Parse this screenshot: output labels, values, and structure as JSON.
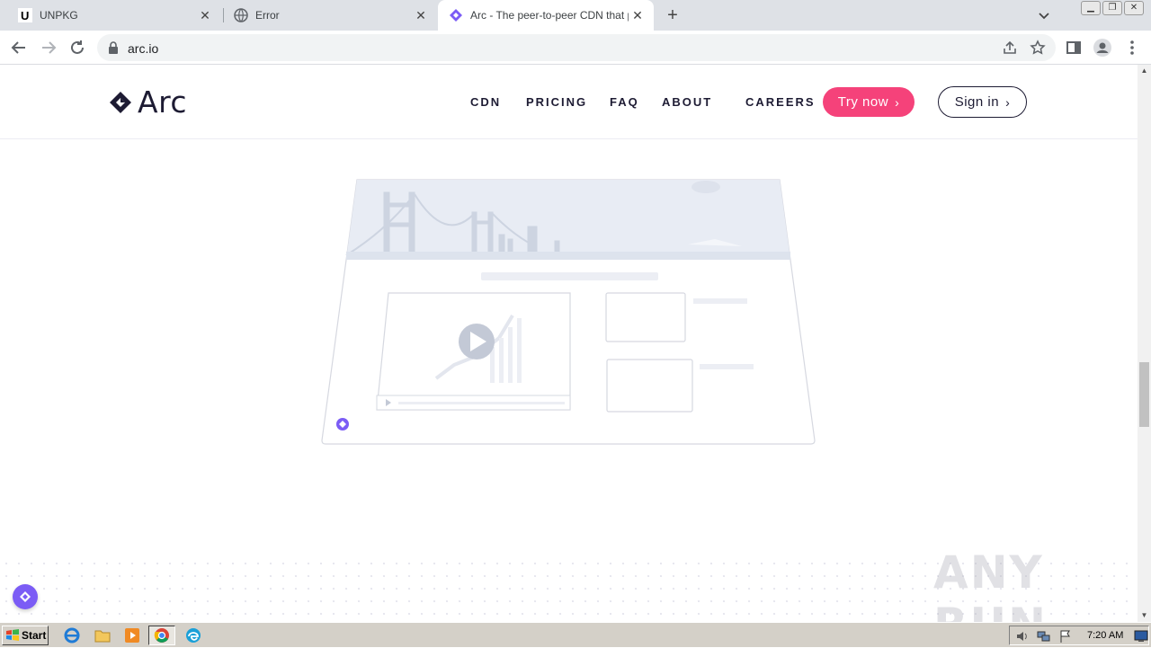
{
  "browser": {
    "tabs": [
      {
        "title": "UNPKG",
        "icon": "unpkg-favicon",
        "active": false
      },
      {
        "title": "Error",
        "icon": "globe-favicon",
        "active": false
      },
      {
        "title": "Arc - The peer-to-peer CDN that pa",
        "icon": "arc-favicon",
        "active": true
      }
    ],
    "url": "arc.io"
  },
  "site": {
    "logo_text": "Arc",
    "nav": [
      "CDN",
      "PRICING",
      "FAQ",
      "ABOUT",
      "CAREERS"
    ],
    "try_now": "Try now",
    "sign_in": "Sign in",
    "brand_color": "#f5427a",
    "accent_color": "#7b5cf5"
  },
  "watermark": "ANY RUN",
  "taskbar": {
    "start_label": "Start",
    "clock": "7:20 AM",
    "apps": [
      "internet-explorer-icon",
      "file-explorer-icon",
      "media-player-icon",
      "chrome-icon",
      "edge-icon"
    ]
  }
}
